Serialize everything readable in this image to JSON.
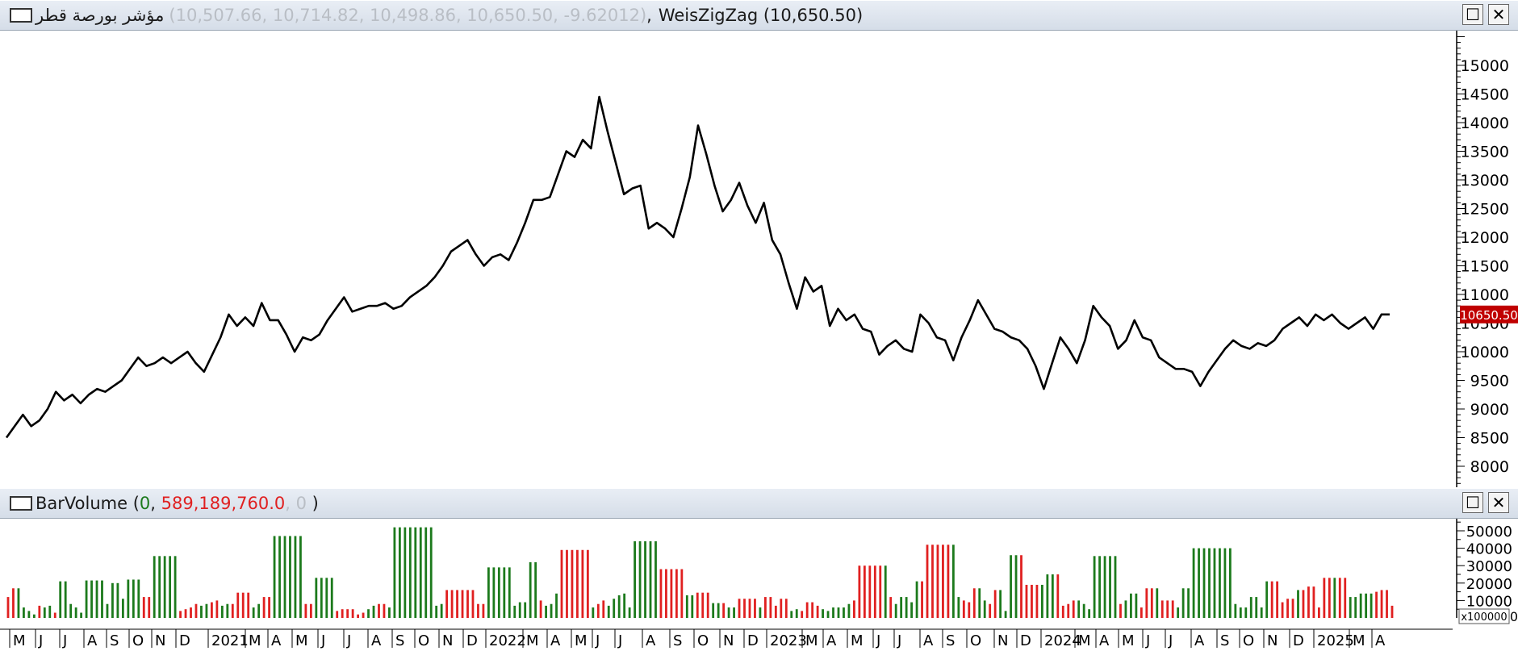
{
  "price_pane": {
    "series_name": "مؤشر بورصة قطر",
    "ohlc": "(10,507.66, 10,714.82, 10,498.86, 10,650.50, -9.62012)",
    "separator": ",",
    "indicator": "WeisZigZag (10,650.50)",
    "last_value_label": "10650.50",
    "window_buttons": {
      "maximize": "☐",
      "close": "✕"
    }
  },
  "volume_pane": {
    "label_name": "BarVolume",
    "label_open": " (",
    "label_v1": "0",
    "label_sep1": ", ",
    "label_v2": "589,189,760.0",
    "label_sep2": ", ",
    "label_v3": "0",
    "label_close": " )",
    "scale_label": "x100000",
    "scale_zero": "0",
    "window_buttons": {
      "maximize": "☐",
      "close": "✕"
    }
  },
  "colors": {
    "up_bar": "#1c7a1c",
    "down_bar": "#e02020",
    "line": "#000000",
    "last_badge": "#c00000"
  },
  "chart_data": [
    {
      "type": "line",
      "title": "مؤشر بورصة قطر",
      "y_ticks": [
        8000,
        8500,
        9000,
        9500,
        10000,
        10500,
        11000,
        11500,
        12000,
        12500,
        13000,
        13500,
        14000,
        14500,
        15000
      ],
      "ylim": [
        7700,
        15500
      ],
      "last_value": 10650.5,
      "x_labels": [
        "M",
        "J",
        "J",
        "A",
        "S",
        "O",
        "N",
        "D",
        "2021",
        "M",
        "A",
        "M",
        "J",
        "J",
        "A",
        "S",
        "O",
        "N",
        "D",
        "2022",
        "M",
        "A",
        "M",
        "J",
        "J",
        "A",
        "S",
        "O",
        "N",
        "D",
        "2023",
        "M",
        "A",
        "M",
        "J",
        "J",
        "A",
        "S",
        "O",
        "N",
        "D",
        "2024",
        "M",
        "A",
        "M",
        "J",
        "J",
        "A",
        "S",
        "O",
        "N",
        "D",
        "2025",
        "M",
        "A"
      ],
      "series": [
        {
          "values": [
            8500,
            8700,
            8900,
            8700,
            8800,
            9000,
            9300,
            9150,
            9250,
            9100,
            9250,
            9350,
            9300,
            9400,
            9500,
            9700,
            9900,
            9750,
            9800,
            9900,
            9800,
            9900,
            10000,
            9800,
            9650,
            9950,
            10250,
            10650,
            10450,
            10600,
            10450,
            10850,
            10550,
            10550,
            10300,
            10000,
            10250,
            10200,
            10300,
            10550,
            10750,
            10950,
            10700,
            10750,
            10800,
            10800,
            10850,
            10750,
            10800,
            10950,
            11050,
            11150,
            11300,
            11500,
            11750,
            11850,
            11950,
            11700,
            11500,
            11650,
            11700,
            11600,
            11900,
            12250,
            12650,
            12650,
            12700,
            13100,
            13500,
            13400,
            13700,
            13550,
            14450,
            13850,
            13300,
            12750,
            12850,
            12900,
            12150,
            12250,
            12150,
            12000,
            12500,
            13050,
            13950,
            13450,
            12900,
            12450,
            12650,
            12950,
            12550,
            12250,
            12600,
            11950,
            11700,
            11200,
            10750,
            11300,
            11050,
            11150,
            10450,
            10750,
            10550,
            10650,
            10400,
            10350,
            9950,
            10100,
            10200,
            10050,
            10000,
            10650,
            10500,
            10250,
            10200,
            9850,
            10250,
            10550,
            10900,
            10650,
            10400,
            10350,
            10250,
            10200,
            10050,
            9750,
            9350,
            9800,
            10250,
            10050,
            9800,
            10200,
            10800,
            10600,
            10450,
            10050,
            10200,
            10550,
            10250,
            10200,
            9900,
            9800,
            9700,
            9700,
            9650,
            9400,
            9650,
            9850,
            10050,
            10200,
            10100,
            10050,
            10150,
            10100,
            10200,
            10400,
            10500,
            10600,
            10450,
            10650,
            10550,
            10650,
            10500,
            10400,
            10500,
            10600,
            10400,
            10650,
            10650
          ]
        }
      ]
    },
    {
      "type": "bar",
      "title": "BarVolume",
      "y_ticks": [
        10000,
        20000,
        30000,
        40000,
        50000
      ],
      "ylim": [
        0,
        54000
      ],
      "unit_multiplier": "x100000",
      "values": [
        12000,
        17000,
        17000,
        6000,
        4000,
        2000,
        7000,
        6000,
        7000,
        3000,
        21000,
        21000,
        8000,
        6000,
        3000,
        21500,
        21500,
        21500,
        21500,
        8000,
        20000,
        20000,
        11000,
        22000,
        22000,
        22000,
        12000,
        12000,
        35500,
        35500,
        35500,
        35500,
        35500,
        4000,
        5000,
        6000,
        8000,
        7000,
        8000,
        9000,
        10000,
        7000,
        8000,
        8000,
        14500,
        14500,
        14500,
        6000,
        8000,
        12000,
        12000,
        47000,
        47000,
        47000,
        47000,
        47000,
        47000,
        8000,
        8000,
        23000,
        23000,
        23000,
        23000,
        4000,
        5000,
        5000,
        5000,
        2000,
        3000,
        5000,
        7000,
        8000,
        8000,
        6000,
        52000,
        52000,
        52000,
        52000,
        52000,
        52000,
        52000,
        52000,
        7000,
        8000,
        16000,
        16000,
        16000,
        16000,
        16000,
        16000,
        8000,
        8000,
        29000,
        29000,
        29000,
        29000,
        29000,
        7000,
        9000,
        9000,
        32000,
        32000,
        10000,
        7000,
        8000,
        14000,
        39000,
        39000,
        39000,
        39000,
        39000,
        39000,
        6000,
        8000,
        10000,
        7000,
        11000,
        13000,
        14000,
        6000,
        44000,
        44000,
        44000,
        44000,
        44000,
        28000,
        28000,
        28000,
        28000,
        28000,
        13000,
        13000,
        14500,
        14500,
        14500,
        8500,
        8500,
        8500,
        6000,
        6000,
        11000,
        11000,
        11000,
        11000,
        6000,
        12000,
        12000,
        7000,
        11000,
        11000,
        4000,
        5000,
        4000,
        9000,
        9000,
        7000,
        5000,
        4000,
        6000,
        6000,
        6000,
        8000,
        10000,
        30000,
        30000,
        30000,
        30000,
        30000,
        30000,
        12000,
        8000,
        12000,
        12000,
        9000,
        21000,
        21000,
        42000,
        42000,
        42000,
        42000,
        42000,
        42000,
        12000,
        10000,
        9000,
        17000,
        17000,
        10000,
        8000,
        16000,
        16000,
        4000,
        36000,
        36000,
        36000,
        19000,
        19000,
        19000,
        19000,
        25000,
        25000,
        25000,
        7000,
        8000,
        10000,
        10000,
        8000,
        5000,
        35500,
        35500,
        35500,
        35500,
        35500,
        8000,
        10000,
        14000,
        14000,
        6000,
        17000,
        17000,
        17000,
        10000,
        10000,
        10000,
        6000,
        17000,
        17000,
        40000,
        40000,
        40000,
        40000,
        40000,
        40000,
        40000,
        40000,
        8000,
        6000,
        6000,
        12000,
        12000,
        6000,
        21000,
        21000,
        21000,
        9000,
        11000,
        11000,
        16000,
        16000,
        18000,
        18000,
        6000,
        23000,
        23000,
        23000,
        23000,
        23000,
        12000,
        12000,
        14000,
        14000,
        14000,
        15000,
        16000,
        16000,
        7000
      ],
      "up": [
        0,
        0,
        1,
        1,
        1,
        1,
        0,
        1,
        1,
        0,
        1,
        1,
        1,
        1,
        1,
        1,
        1,
        1,
        1,
        1,
        1,
        1,
        1,
        1,
        1,
        1,
        0,
        0,
        1,
        1,
        1,
        1,
        1,
        0,
        0,
        0,
        0,
        1,
        1,
        0,
        0,
        1,
        1,
        0,
        0,
        0,
        0,
        1,
        1,
        0,
        0,
        1,
        1,
        1,
        1,
        1,
        1,
        0,
        0,
        1,
        1,
        1,
        1,
        0,
        0,
        0,
        0,
        0,
        0,
        1,
        1,
        0,
        0,
        1,
        1,
        1,
        1,
        1,
        1,
        1,
        1,
        1,
        1,
        1,
        0,
        0,
        0,
        0,
        0,
        0,
        0,
        0,
        1,
        1,
        1,
        1,
        1,
        1,
        1,
        1,
        1,
        1,
        0,
        1,
        1,
        1,
        0,
        0,
        0,
        0,
        0,
        0,
        1,
        0,
        0,
        1,
        1,
        1,
        1,
        1,
        1,
        1,
        1,
        1,
        1,
        0,
        0,
        0,
        0,
        0,
        1,
        1,
        0,
        0,
        0,
        1,
        1,
        0,
        1,
        1,
        0,
        0,
        0,
        0,
        1,
        0,
        0,
        0,
        0,
        0,
        1,
        1,
        0,
        0,
        0,
        0,
        1,
        1,
        1,
        1,
        1,
        1,
        0,
        0,
        0,
        0,
        0,
        0,
        1,
        0,
        1,
        1,
        1,
        1,
        1,
        0,
        0,
        0,
        0,
        0,
        0,
        1,
        1,
        0,
        0,
        0,
        1,
        1,
        0,
        0,
        1,
        1,
        1,
        1,
        0,
        0,
        0,
        0,
        1,
        1,
        1,
        0,
        0,
        0,
        0,
        1,
        1,
        1,
        1,
        1,
        1,
        1,
        1,
        0,
        1,
        1,
        1,
        0,
        0,
        0,
        1,
        0,
        0,
        0,
        1,
        1,
        1,
        1,
        1,
        1,
        1,
        1,
        1,
        1,
        1,
        1,
        1,
        1,
        1,
        1,
        1,
        1,
        0,
        0,
        0,
        0,
        0,
        1,
        0,
        0,
        0,
        0,
        0,
        0,
        1,
        0,
        0,
        1,
        1,
        1,
        1,
        1,
        0
      ]
    }
  ]
}
